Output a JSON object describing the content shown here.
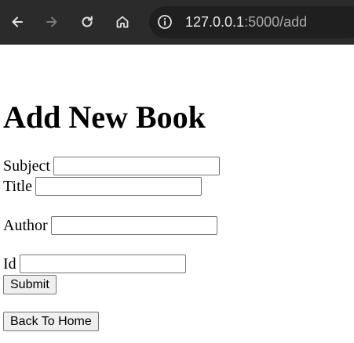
{
  "browser": {
    "url_host": "127.0.0.1",
    "url_path": ":5000/add",
    "icons": [
      "back-icon",
      "forward-icon",
      "reload-icon",
      "home-icon",
      "info-icon"
    ],
    "colors": {
      "toolbar": "#2b2b2b",
      "omnibox": "#1f1f1f",
      "url_host": "#e8e8e8",
      "url_path": "#a9a9a9"
    }
  },
  "page": {
    "title": "Add New Book",
    "form": {
      "subject_label": "Subject",
      "subject_value": "",
      "title_label": "Title",
      "title_value": "",
      "author_label": "Author",
      "author_value": "",
      "id_label": "Id",
      "id_value": "",
      "submit_label": "Submit"
    },
    "back_home_label": "Back To Home"
  }
}
